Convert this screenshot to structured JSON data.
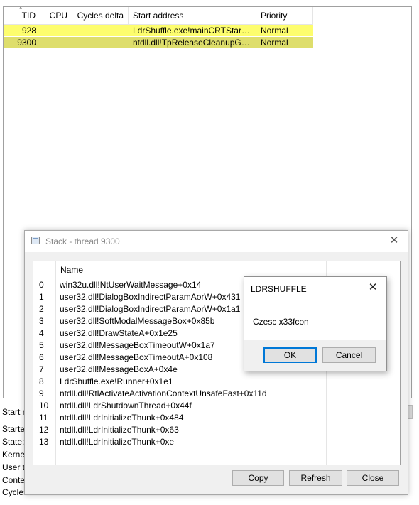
{
  "threads": {
    "columns": [
      "TID",
      "CPU",
      "Cycles delta",
      "Start address",
      "Priority"
    ],
    "rows": [
      {
        "tid": "928",
        "cpu": "",
        "cycles": "",
        "start": "LdrShuffle.exe!mainCRTStartup",
        "priority": "Normal",
        "color": "#fdfd6e"
      },
      {
        "tid": "9300",
        "cpu": "",
        "cycles": "",
        "start": "ntdll.dll!TpReleaseCleanupGroup...",
        "priority": "Normal",
        "color": "#dede6c"
      }
    ]
  },
  "details": {
    "start_label": "Start m",
    "started_label": "Starte",
    "state_label": "State:",
    "kernel_label": "Kernel",
    "user_label": "User ti",
    "context_label": "Contex",
    "cycles_label": "Cycles"
  },
  "stack": {
    "title": "Stack - thread 9300",
    "column_name": "Name",
    "frames": [
      {
        "idx": "0",
        "name": "win32u.dll!NtUserWaitMessage+0x14"
      },
      {
        "idx": "1",
        "name": "user32.dll!DialogBoxIndirectParamAorW+0x431"
      },
      {
        "idx": "2",
        "name": "user32.dll!DialogBoxIndirectParamAorW+0x1a1"
      },
      {
        "idx": "3",
        "name": "user32.dll!SoftModalMessageBox+0x85b"
      },
      {
        "idx": "4",
        "name": "user32.dll!DrawStateA+0x1e25"
      },
      {
        "idx": "5",
        "name": "user32.dll!MessageBoxTimeoutW+0x1a7"
      },
      {
        "idx": "6",
        "name": "user32.dll!MessageBoxTimeoutA+0x108"
      },
      {
        "idx": "7",
        "name": "user32.dll!MessageBoxA+0x4e"
      },
      {
        "idx": "8",
        "name": "LdrShuffle.exe!Runner+0x1e1"
      },
      {
        "idx": "9",
        "name": "ntdll.dll!RtlActivateActivationContextUnsafeFast+0x11d"
      },
      {
        "idx": "10",
        "name": "ntdll.dll!LdrShutdownThread+0x44f"
      },
      {
        "idx": "11",
        "name": "ntdll.dll!LdrInitializeThunk+0x484"
      },
      {
        "idx": "12",
        "name": "ntdll.dll!LdrInitializeThunk+0x63"
      },
      {
        "idx": "13",
        "name": "ntdll.dll!LdrInitializeThunk+0xe"
      }
    ],
    "copy_label": "Copy",
    "refresh_label": "Refresh",
    "close_label": "Close"
  },
  "msgbox": {
    "title": "LDRSHUFFLE",
    "message": "Czesc x33fcon",
    "ok_label": "OK",
    "cancel_label": "Cancel"
  }
}
